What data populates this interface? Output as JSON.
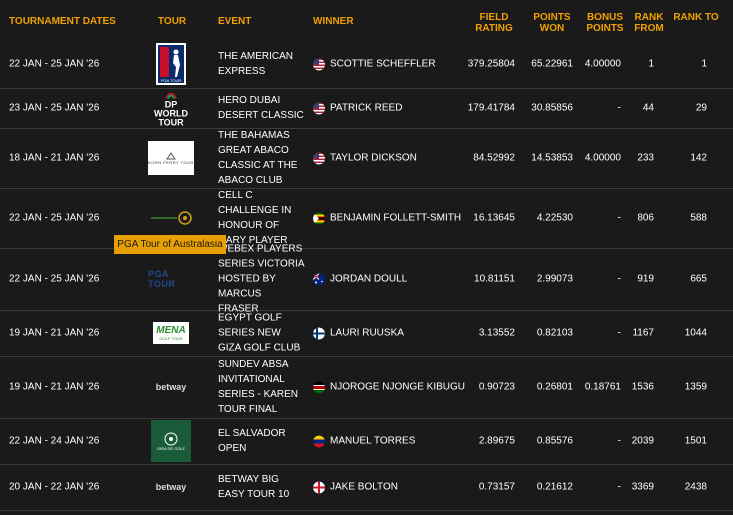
{
  "header": {
    "dates": "TOURNAMENT DATES",
    "tour": "TOUR",
    "event": "EVENT",
    "winner": "WINNER",
    "field_rating": "FIELD RATING",
    "points_won": "POINTS WON",
    "bonus_points": "BONUS POINTS",
    "rank_from": "RANK FROM",
    "rank_to": "RANK TO"
  },
  "tooltip": "PGA Tour of Australasia",
  "rows": [
    {
      "dates": "22 JAN - 25 JAN '26",
      "tour": "pga-tour-logo",
      "event": "THE AMERICAN EXPRESS",
      "winner": "SCOTTIE SCHEFFLER",
      "flag": "usa-flag-icon",
      "field_rating": "379.25804",
      "points_won": "65.22961",
      "bonus_points": "4.00000",
      "rank_from": "1",
      "rank_to": "1"
    },
    {
      "dates": "23 JAN - 25 JAN '26",
      "tour": "dp-world-tour-logo",
      "event": "HERO DUBAI DESERT CLASSIC",
      "winner": "PATRICK REED",
      "flag": "usa-flag-icon",
      "field_rating": "179.41784",
      "points_won": "30.85856",
      "bonus_points": "-",
      "rank_from": "44",
      "rank_to": "29",
      "logo_text": "DP WORLD TOUR"
    },
    {
      "dates": "18 JAN - 21 JAN '26",
      "tour": "korn-ferry-tour-logo",
      "event": "THE BAHAMAS GREAT ABACO CLASSIC AT THE ABACO CLUB",
      "winner": "TAYLOR DICKSON",
      "flag": "usa-flag-icon",
      "field_rating": "84.52992",
      "points_won": "14.53853",
      "bonus_points": "4.00000",
      "rank_from": "233",
      "rank_to": "142",
      "logo_text": "KORN FERRY TOUR"
    },
    {
      "dates": "22 JAN - 25 JAN '26",
      "tour": "sunshine-tour-logo",
      "event": "CELL C CHALLENGE IN HONOUR OF GARY PLAYER",
      "winner": "BENJAMIN FOLLETT-SMITH",
      "flag": "zimbabwe-flag-icon",
      "field_rating": "16.13645",
      "points_won": "4.22530",
      "bonus_points": "-",
      "rank_from": "806",
      "rank_to": "588"
    },
    {
      "dates": "22 JAN - 25 JAN '26",
      "tour": "pga-tour-australasia-logo",
      "event": "WEBEX PLAYERS SERIES VICTORIA HOSTED BY MARCUS FRASER",
      "winner": "JORDAN DOULL",
      "flag": "australia-flag-icon",
      "field_rating": "10.81151",
      "points_won": "2.99073",
      "bonus_points": "-",
      "rank_from": "919",
      "rank_to": "665",
      "logo_text": "PGA TOUR"
    },
    {
      "dates": "19 JAN - 21 JAN '26",
      "tour": "mena-golf-tour-logo",
      "event": "EGYPT GOLF SERIES NEW GIZA GOLF CLUB",
      "winner": "LAURI RUUSKA",
      "flag": "finland-flag-icon",
      "field_rating": "3.13552",
      "points_won": "0.82103",
      "bonus_points": "-",
      "rank_from": "1167",
      "rank_to": "1044",
      "logo_text": "MENA",
      "logo_sub": "GOLF TOUR"
    },
    {
      "dates": "19 JAN - 21 JAN '26",
      "tour": "betway-tour-logo",
      "event": "SUNDEV ABSA INVITATIONAL SERIES - KAREN TOUR FINAL",
      "winner": "NJOROGE NJONGE KIBUGU",
      "flag": "kenya-flag-icon",
      "field_rating": "0.90723",
      "points_won": "0.26801",
      "bonus_points": "0.18761",
      "rank_from": "1536",
      "rank_to": "1359",
      "logo_text": "betway"
    },
    {
      "dates": "22 JAN - 24 JAN '26",
      "tour": "gira-de-golf-logo",
      "event": "EL SALVADOR OPEN",
      "winner": "MANUEL TORRES",
      "flag": "venezuela-flag-icon",
      "field_rating": "2.89675",
      "points_won": "0.85576",
      "bonus_points": "-",
      "rank_from": "2039",
      "rank_to": "1501",
      "logo_text": "GIRA DE GOLF"
    },
    {
      "dates": "20 JAN - 22 JAN '26",
      "tour": "betway-tour-logo",
      "event": "BETWAY BIG EASY TOUR 10",
      "winner": "JAKE BOLTON",
      "flag": "england-flag-icon",
      "field_rating": "0.73157",
      "points_won": "0.21612",
      "bonus_points": "-",
      "rank_from": "3369",
      "rank_to": "2438",
      "logo_text": "betway"
    }
  ]
}
